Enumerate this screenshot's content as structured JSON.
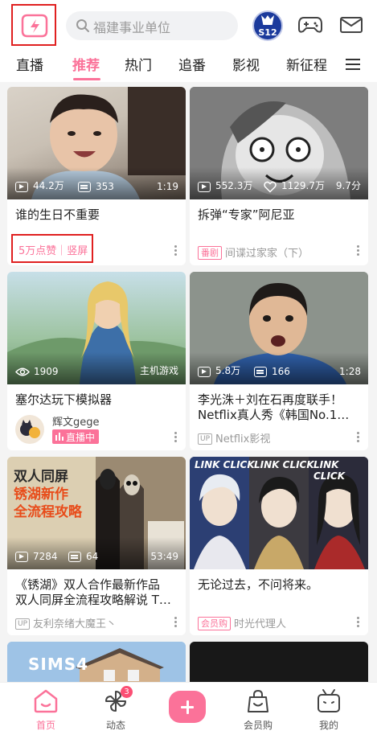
{
  "header": {
    "search_placeholder": "福建事业单位",
    "event_badge_text": "S12"
  },
  "tabs": [
    "直播",
    "推荐",
    "热门",
    "追番",
    "影视",
    "新征程"
  ],
  "active_tab": "推荐",
  "feed": [
    {
      "views": "44.2万",
      "danmaku": "353",
      "duration": "1:19",
      "title": "谁的生日不重要",
      "meta": "5万点赞｜竖屏"
    },
    {
      "views": "552.3万",
      "likes": "1129.7万",
      "rating": "9.7分",
      "title": "拆弹“专家”阿尼亚",
      "tag": "番剧",
      "meta": "间谍过家家（下）"
    },
    {
      "views": "1909",
      "category": "主机游戏",
      "title": "塞尔达玩下模拟器",
      "author": "辉文gege",
      "live_label": "直播中"
    },
    {
      "views": "5.8万",
      "danmaku": "166",
      "duration": "1:28",
      "title_line1": "李光洙＋刘在石再度联手！",
      "title_line2": "Netflix真人秀《韩国No.1…",
      "up_label": "UP",
      "meta": "Netflix影视"
    },
    {
      "views": "7284",
      "danmaku": "64",
      "duration": "53:49",
      "title_line1": "《锈湖》双人合作最新作品",
      "title_line2": "双人同屏全流程攻略解说 T…",
      "up_label": "UP",
      "meta": "友利奈绪大魔王丶",
      "thumb_line1": "双人同屏",
      "thumb_line2": "锈湖新作",
      "thumb_line3": "全流程攻略"
    },
    {
      "title": "无论过去，不问将来。",
      "tag": "会员购",
      "meta": "时光代理人",
      "thumb_text": "LINK CLICK"
    },
    {
      "thumb_text": "SIMS4"
    }
  ],
  "bottom_nav": [
    {
      "label": "首页",
      "active": true
    },
    {
      "label": "动态",
      "badge": "3"
    },
    {
      "label": ""
    },
    {
      "label": "会员购"
    },
    {
      "label": "我的"
    }
  ],
  "colors": {
    "accent": "#fb7299",
    "highlight_box": "#e02020"
  }
}
